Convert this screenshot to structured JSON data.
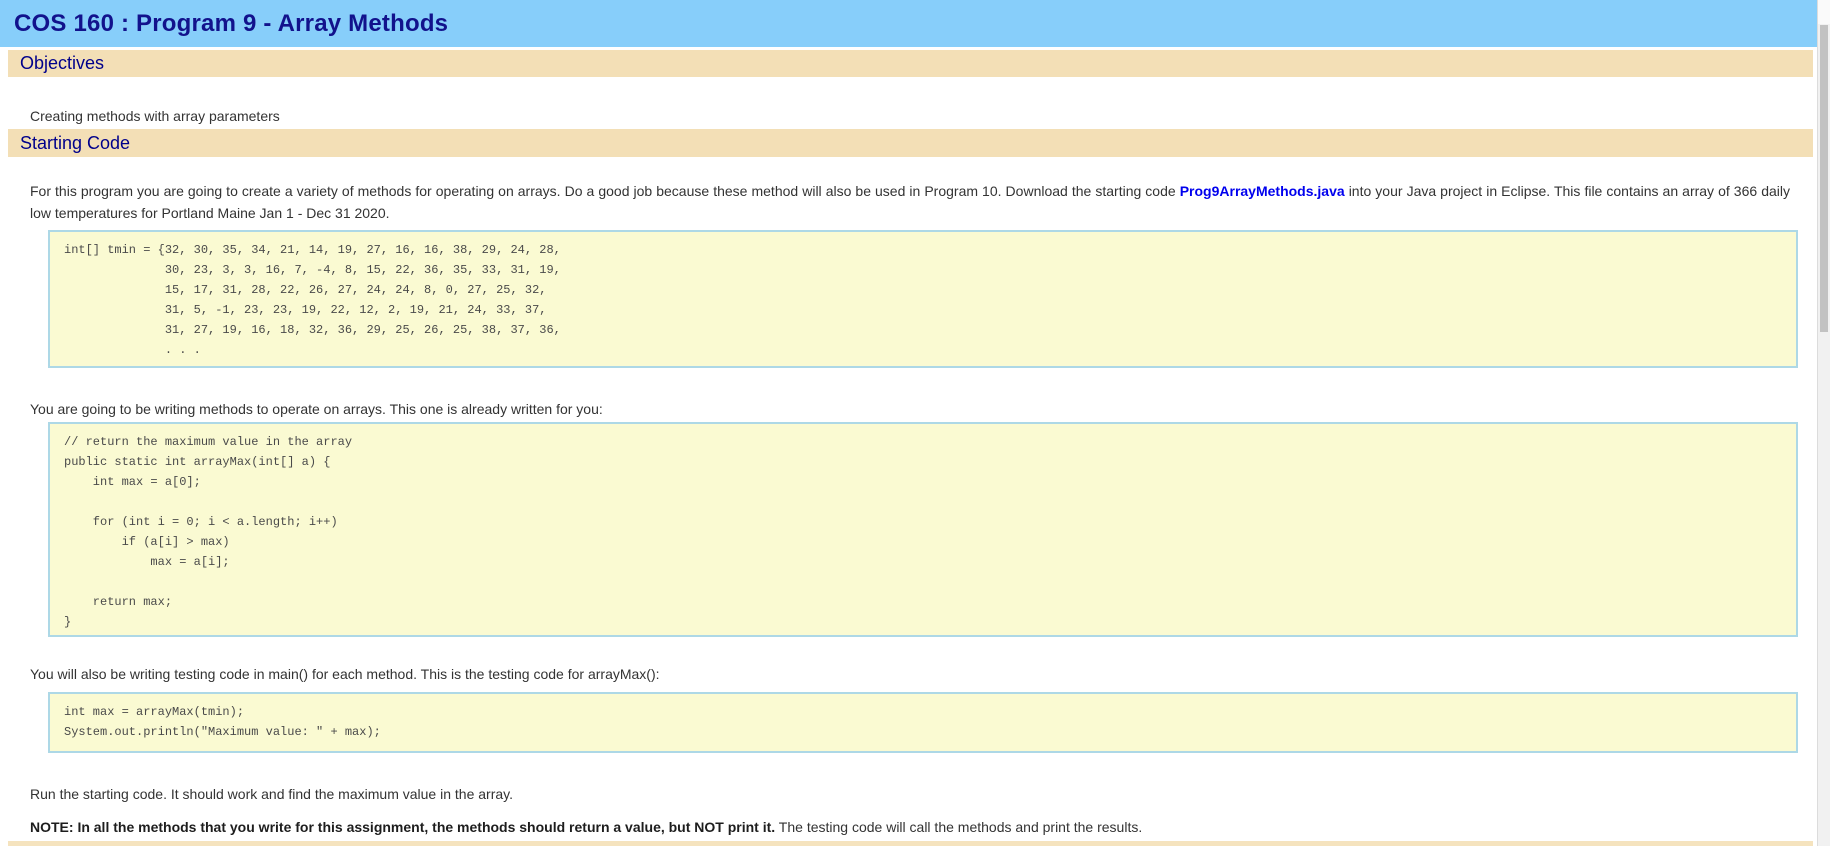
{
  "title_bar": {
    "title": "COS 160 : Program 9 - Array Methods"
  },
  "objectives": {
    "heading": "Objectives",
    "text": "Creating methods with array parameters"
  },
  "starting_code": {
    "heading": "Starting Code",
    "intro": {
      "before_link": "For this program you are going to create a variety of methods for operating on arrays. Do a good job because these method will also be used in Program 10. Download the starting code ",
      "link": "Prog9ArrayMethods.java",
      "after_link": " into your Java project in Eclipse. This file contains an array of 366 daily low temperatures for Portland Maine Jan 1 - Dec 31 2020."
    },
    "tmin_code": "int[] tmin = {32, 30, 35, 34, 21, 14, 19, 27, 16, 16, 38, 29, 24, 28,\n              30, 23, 3, 3, 16, 7, -4, 8, 15, 22, 36, 35, 33, 31, 19,\n              15, 17, 31, 28, 22, 26, 27, 24, 24, 8, 0, 27, 25, 32,\n              31, 5, -1, 23, 23, 19, 22, 12, 2, 19, 21, 24, 33, 37,\n              31, 27, 19, 16, 18, 32, 36, 29, 25, 26, 25, 38, 37, 36,\n              . . .",
    "already_written_text": "You are going to be writing methods to operate on arrays. This one is already written for you:",
    "arraymax_code": "// return the maximum value in the array\npublic static int arrayMax(int[] a) {\n    int max = a[0];\n\n    for (int i = 0; i < a.length; i++)\n        if (a[i] > max)\n            max = a[i];\n\n    return max;\n}",
    "testing_text": "You will also be writing testing code in main() for each method. This is the testing code for arrayMax():",
    "testing_code": "int max = arrayMax(tmin);\nSystem.out.println(\"Maximum value: \" + max);",
    "run_text": "Run the starting code. It should work and find the maximum value in the array.",
    "note": {
      "bold": "NOTE: In all the methods that you write for this assignment, the methods should return a value, but NOT print it.",
      "rest": " The testing code will call the methods and print the results."
    }
  },
  "colors": {
    "header_bg": "#87CEFA",
    "section_bg": "#F3DFB6",
    "heading_text": "#00008B",
    "title_text": "#12128C",
    "code_bg": "#FAFAD2",
    "code_border": "#ADD8E6",
    "code_text": "#4A4A4A",
    "link": "#0000EE",
    "body_text": "#333333",
    "scrollbar_track": "#F1F1F1",
    "scrollbar_thumb": "#C2C2C2"
  }
}
